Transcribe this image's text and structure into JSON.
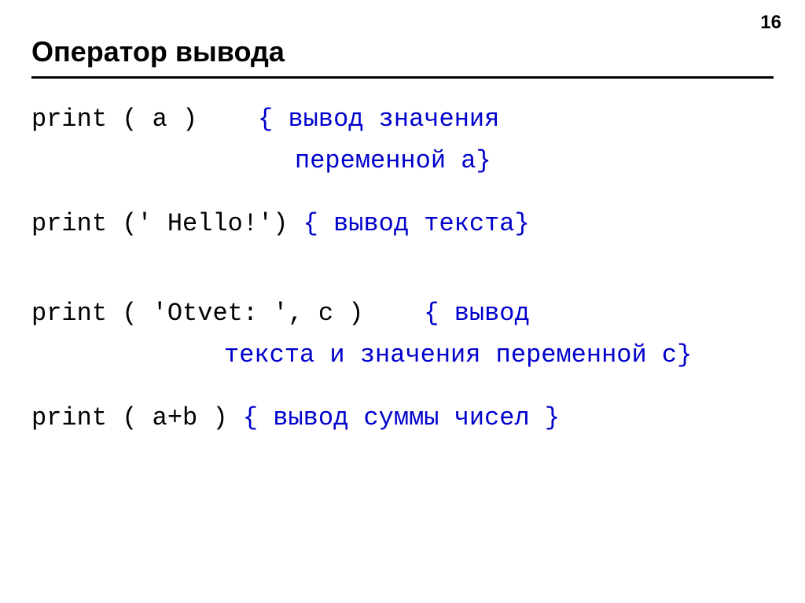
{
  "page_number": "16",
  "title": "Оператор вывода",
  "lines": {
    "l1_code": "print ( a )",
    "l1_comment_a": "{ вывод значения",
    "l1_comment_b": "переменной a}",
    "l2_code": "print (' Hello!')",
    "l2_comment": "{ вывод текста}",
    "l3_code": "print ( 'Otvet: ', c )",
    "l3_comment_a": "{ вывод",
    "l3_comment_b": "текста и значения переменной c}",
    "l4_code": "print ( a+b )",
    "l4_comment": "{ вывод суммы чисел }"
  }
}
